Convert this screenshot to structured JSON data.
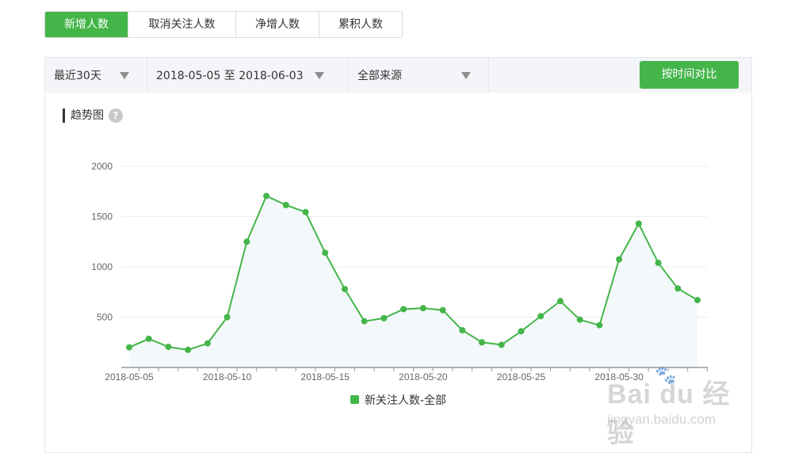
{
  "tabs": [
    {
      "label": "新增人数",
      "active": true
    },
    {
      "label": "取消关注人数",
      "active": false
    },
    {
      "label": "净增人数",
      "active": false
    },
    {
      "label": "累积人数",
      "active": false
    }
  ],
  "filters": {
    "range": "最近30天",
    "dates": "2018-05-05 至 2018-06-03",
    "source": "全部来源",
    "compare_button": "按时间对比"
  },
  "section": {
    "title": "趋势图",
    "help": "?"
  },
  "colors": {
    "accent": "#44b549",
    "line": "#44b549",
    "area": "#f3f8fa"
  },
  "chart_data": {
    "type": "line",
    "x": [
      "2018-05-05",
      "2018-05-06",
      "2018-05-07",
      "2018-05-08",
      "2018-05-09",
      "2018-05-10",
      "2018-05-11",
      "2018-05-12",
      "2018-05-13",
      "2018-05-14",
      "2018-05-15",
      "2018-05-16",
      "2018-05-17",
      "2018-05-18",
      "2018-05-19",
      "2018-05-20",
      "2018-05-21",
      "2018-05-22",
      "2018-05-23",
      "2018-05-24",
      "2018-05-25",
      "2018-05-26",
      "2018-05-27",
      "2018-05-28",
      "2018-05-29",
      "2018-05-30",
      "2018-05-31",
      "2018-06-01",
      "2018-06-02"
    ],
    "series": [
      {
        "name": "新关注人数-全部",
        "values": [
          200,
          285,
          205,
          175,
          240,
          500,
          1250,
          1705,
          1615,
          1545,
          1140,
          780,
          460,
          490,
          580,
          590,
          570,
          370,
          250,
          225,
          360,
          510,
          660,
          475,
          420,
          1075,
          1430,
          1040,
          785,
          670
        ]
      }
    ],
    "x_tick_labels": [
      "2018-05-05",
      "2018-05-10",
      "2018-05-15",
      "2018-05-20",
      "2018-05-25",
      "2018-05-30"
    ],
    "y_tick_labels": [
      "500",
      "1000",
      "1500",
      "2000"
    ],
    "ylim": [
      0,
      2000
    ],
    "grid": true,
    "legend": "bottom-center"
  },
  "watermark": {
    "logo": "Bai du 经验",
    "url": "jingyan.baidu.com"
  }
}
